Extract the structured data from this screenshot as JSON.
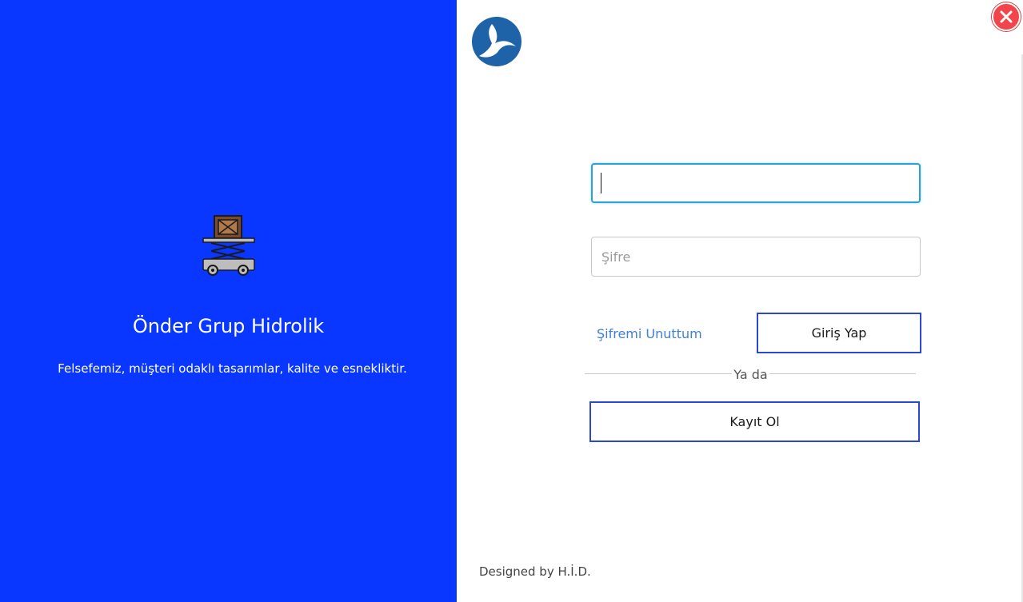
{
  "brand": {
    "title": "Önder Grup Hidrolik",
    "tagline": "Felsefemiz, müşteri odaklı tasarımlar, kalite ve esnekliktir.",
    "illustration_icon": "scissor-lift-icon",
    "panel_color": "#0a37ff"
  },
  "login": {
    "logo_icon": "company-logo-icon",
    "username": {
      "value": "",
      "placeholder": ""
    },
    "password": {
      "value": "",
      "placeholder": "Şifre"
    },
    "forgot_label": "Şifremi Unuttum",
    "login_label": "Giriş Yap",
    "divider_label": "Ya da",
    "register_label": "Kayıt Ol",
    "footer": "Designed by H.İ.D.",
    "accent_color": "#2b48d0",
    "link_color": "#3f7fd9"
  },
  "window": {
    "close_icon": "close-icon",
    "close_color": "#f1454b"
  }
}
